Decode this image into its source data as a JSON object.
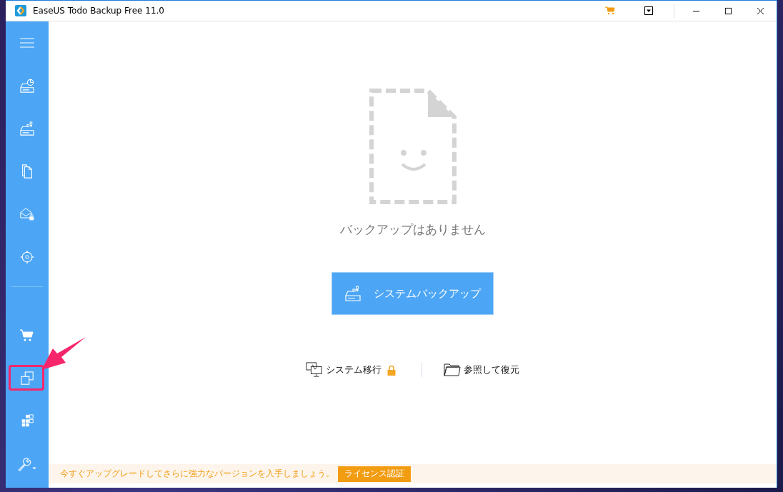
{
  "window": {
    "title": "EaseUS Todo Backup Free 11.0"
  },
  "sidebar": {
    "top_items": [
      {
        "highlighted": false
      },
      {
        "highlighted": false
      },
      {
        "highlighted": false
      },
      {
        "highlighted": false
      },
      {
        "highlighted": false
      }
    ],
    "bottom_items": [
      {
        "highlighted": false
      },
      {
        "highlighted": true
      },
      {
        "highlighted": false
      },
      {
        "highlighted": false
      }
    ]
  },
  "empty_state": {
    "message": "バックアップはありません"
  },
  "primary_button": {
    "label": "システムバックアップ"
  },
  "links": [
    {
      "label": "システム移行",
      "locked": true
    },
    {
      "label": "参照して復元",
      "locked": false
    }
  ],
  "banner": {
    "message": "今すぐアップグレードしてさらに強力なバージョンを入手しましょう。",
    "button": "ライセンス認証"
  }
}
